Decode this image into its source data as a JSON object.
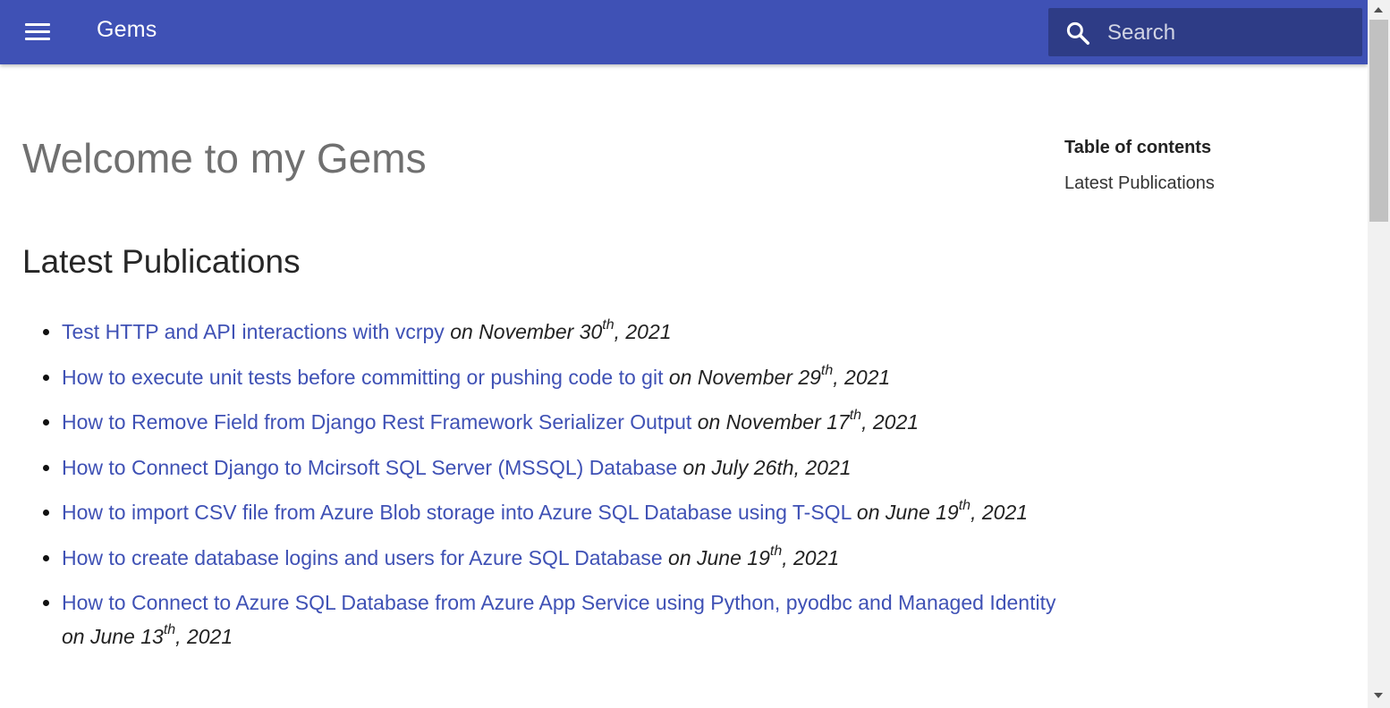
{
  "header": {
    "site_title": "Gems",
    "search": {
      "placeholder": "Search"
    }
  },
  "main": {
    "page_title": "Welcome to my Gems",
    "section_title": "Latest Publications",
    "publications": [
      {
        "title": "Test HTTP and API interactions with vcrpy",
        "date_prefix": "on November 30",
        "date_sup": "th",
        "date_suffix": ", 2021"
      },
      {
        "title": "How to execute unit tests before committing or pushing code to git",
        "date_prefix": "on November 29",
        "date_sup": "th",
        "date_suffix": ", 2021"
      },
      {
        "title": "How to Remove Field from Django Rest Framework Serializer Output",
        "date_prefix": "on November 17",
        "date_sup": "th",
        "date_suffix": ", 2021"
      },
      {
        "title": "How to Connect Django to Mcirsoft SQL Server (MSSQL) Database",
        "date_prefix": "on July 26th, 2021",
        "date_sup": "",
        "date_suffix": ""
      },
      {
        "title": "How to import CSV file from Azure Blob storage into Azure SQL Database using T-SQL",
        "date_prefix": "on June 19",
        "date_sup": "th",
        "date_suffix": ", 2021"
      },
      {
        "title": "How to create database logins and users for Azure SQL Database",
        "date_prefix": "on June 19",
        "date_sup": "th",
        "date_suffix": ", 2021"
      },
      {
        "title": "How to Connect to Azure SQL Database from Azure App Service using Python, pyodbc and Managed Identity",
        "date_prefix": "on June 13",
        "date_sup": "th",
        "date_suffix": ", 2021"
      }
    ]
  },
  "toc": {
    "title": "Table of contents",
    "items": [
      {
        "label": "Latest Publications"
      }
    ]
  },
  "colors": {
    "header_bg": "#3f51b5",
    "link": "#3f51b5"
  },
  "icons": {
    "menu": "hamburger-menu-icon",
    "search": "search-icon"
  }
}
